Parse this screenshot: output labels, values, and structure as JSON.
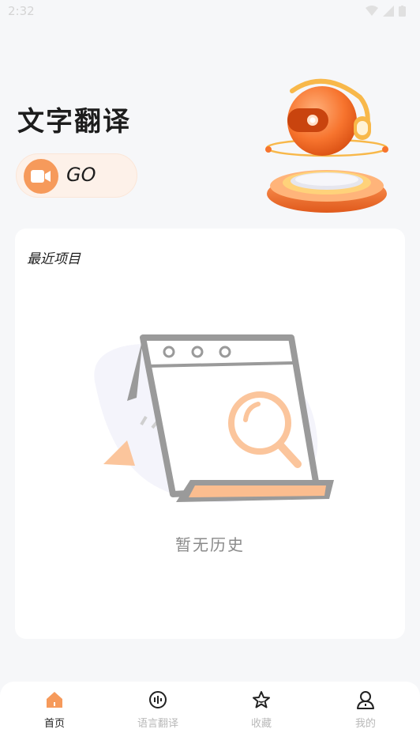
{
  "status_bar": {
    "time": "2:32"
  },
  "header": {
    "title": "文字翻译",
    "go_button_label": "GO"
  },
  "recent": {
    "title": "最近项目",
    "empty_text": "暂无历史"
  },
  "tabbar": {
    "items": [
      {
        "label": "首页",
        "icon": "home-icon",
        "active": true
      },
      {
        "label": "语言翻译",
        "icon": "voice-icon",
        "active": false
      },
      {
        "label": "收藏",
        "icon": "star-icon",
        "active": false
      },
      {
        "label": "我的",
        "icon": "user-icon",
        "active": false
      }
    ]
  },
  "colors": {
    "accent": "#f69a5b",
    "accent_light": "#fdf1e9",
    "text_primary": "#1d1d1d",
    "text_muted": "#b9b9b9"
  }
}
